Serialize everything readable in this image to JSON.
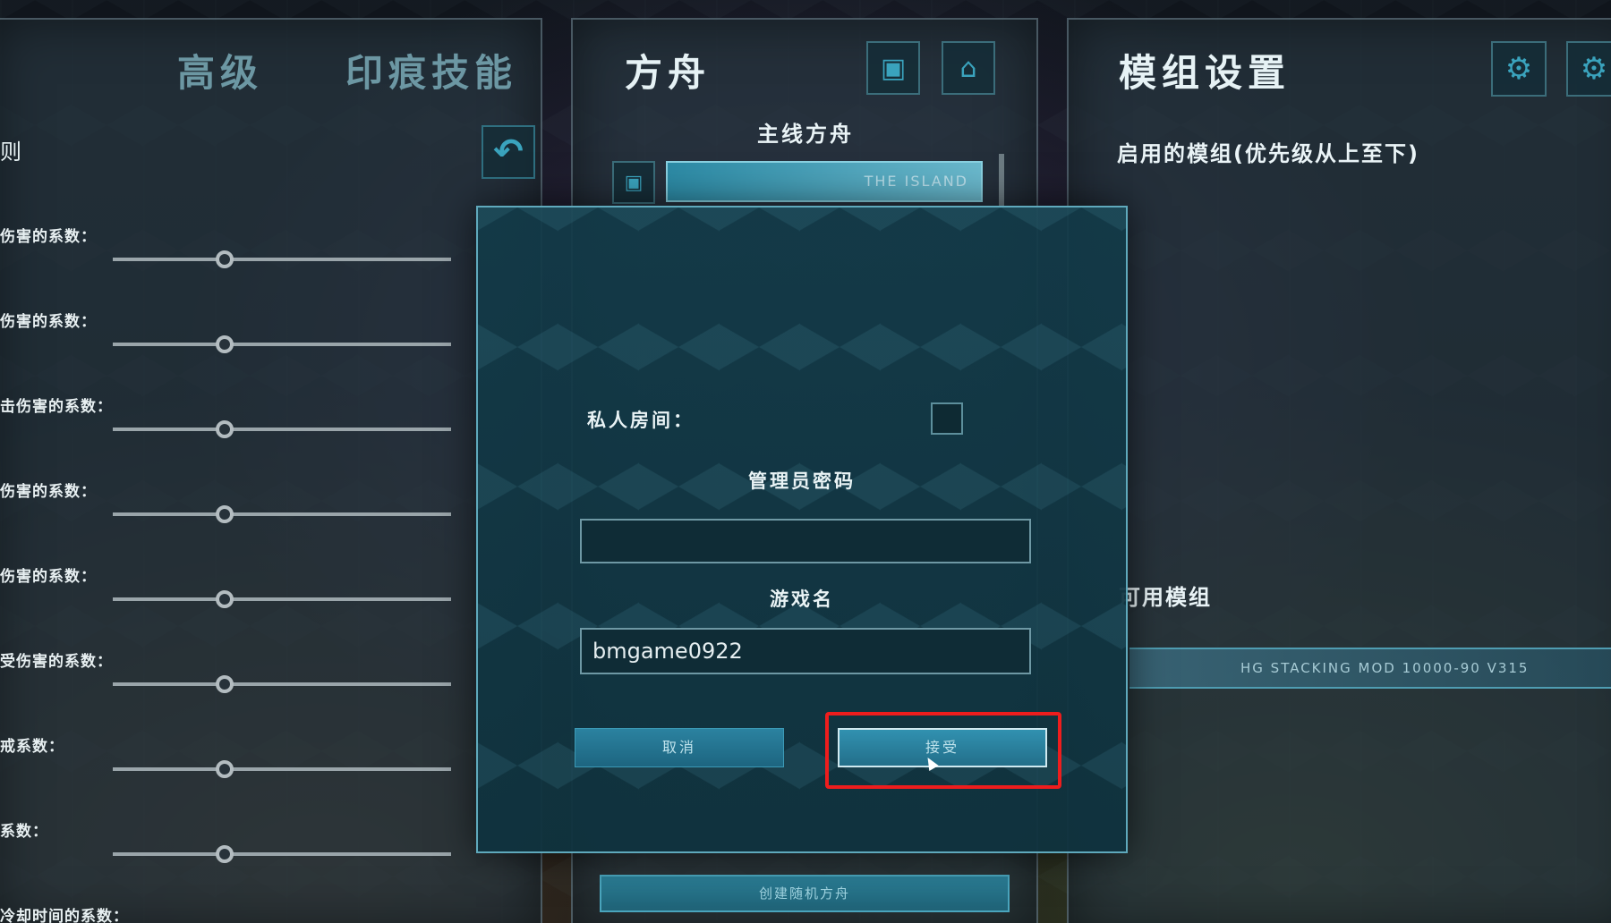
{
  "left_panel": {
    "tabs": [
      "高级",
      "印痕技能"
    ],
    "section": "则",
    "settings": [
      {
        "label": "伤害的系数：",
        "level": 0.33
      },
      {
        "label": "伤害的系数：",
        "level": 0.33
      },
      {
        "label": "击伤害的系数：",
        "level": 0.33
      },
      {
        "label": "伤害的系数：",
        "level": 0.33
      },
      {
        "label": "伤害的系数：",
        "level": 0.33
      },
      {
        "label": "受伤害的系数：",
        "level": 0.33
      },
      {
        "label": "戒系数：",
        "level": 0.33
      },
      {
        "label": "系数：",
        "level": 0.33
      },
      {
        "label": "冷却时间的系数：",
        "level": null
      }
    ]
  },
  "ark_panel": {
    "title": "方舟",
    "mainline_label": "主线方舟",
    "selected_map": "THE  ISLAND",
    "random_ark_button": "创建随机方舟"
  },
  "mod_panel": {
    "title": "模组设置",
    "enabled_label": "启用的模组(优先级从上至下)",
    "available_label": "可用模组",
    "available_mods": [
      "HG  STACKING  MOD  10000-90  V315"
    ]
  },
  "dialog": {
    "private_room_label": "私人房间：",
    "private_room_checked": false,
    "admin_password_label": "管理员密码",
    "admin_password_value": "",
    "game_name_label": "游戏名",
    "game_name_value": "bmgame0922",
    "cancel_label": "取消",
    "accept_label": "接受"
  },
  "colors": {
    "accent": "#2b82a0",
    "highlight": "#ee1d1d"
  }
}
